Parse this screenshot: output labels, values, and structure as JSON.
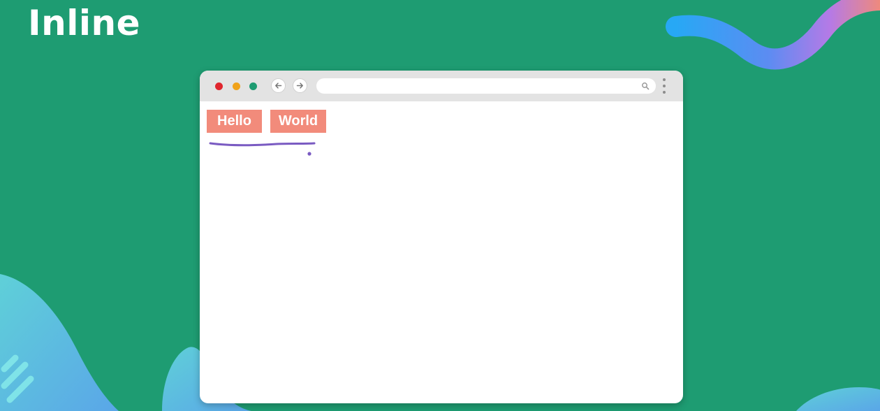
{
  "slide": {
    "title": "Inline"
  },
  "browser": {
    "window_controls": [
      {
        "name": "close",
        "color": "#e0262e"
      },
      {
        "name": "minimize",
        "color": "#f0a21a"
      },
      {
        "name": "maximize",
        "color": "#1e9c72"
      }
    ],
    "nav": {
      "back_icon": "arrow-left-icon",
      "forward_icon": "arrow-right-icon"
    },
    "address_bar": {
      "value": "",
      "icon": "search-icon"
    },
    "menu_icon": "kebab-menu-icon"
  },
  "content": {
    "boxes": [
      {
        "label": "Hello"
      },
      {
        "label": "World"
      }
    ],
    "box_color": "#f28b7b"
  },
  "colors": {
    "background": "#1e9c72",
    "annotation_ink": "#7a5bc2"
  }
}
